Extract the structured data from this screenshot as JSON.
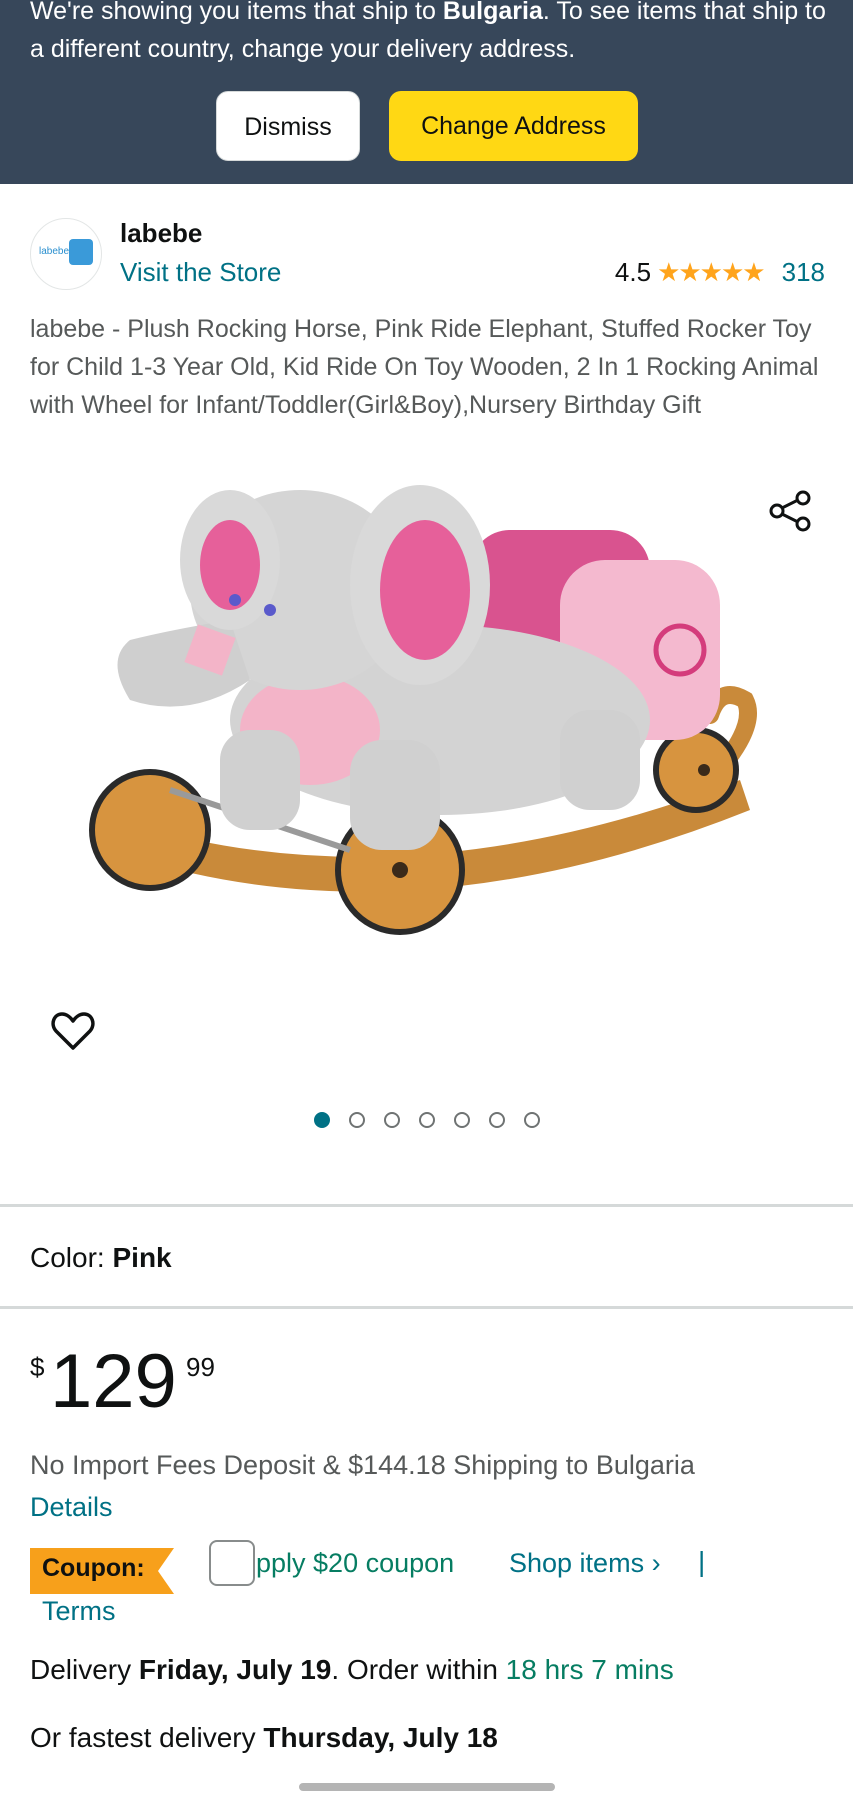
{
  "banner": {
    "text_part1": "We're showing you items that ship to ",
    "country": "Bulgaria",
    "text_part2": ". To see items that ship to a different country, change your delivery address.",
    "dismiss_label": "Dismiss",
    "change_address_label": "Change Address"
  },
  "store": {
    "logo_text": "labebe",
    "brand": "labebe",
    "visit_label": "Visit the Store",
    "rating": "4.5",
    "stars": "★★★★★",
    "rating_count": "318"
  },
  "product": {
    "title": "labebe - Plush Rocking Horse, Pink Ride Elephant, Stuffed Rocker Toy for Child 1-3 Year Old, Kid Ride On Toy Wooden, 2 In 1 Rocking Animal with Wheel for Infant/Toddler(Girl&Boy),Nursery Birthday Gift",
    "image_count": 7,
    "active_image_index": 0
  },
  "color": {
    "label": "Color:",
    "value": "Pink"
  },
  "price": {
    "symbol": "$",
    "whole": "129",
    "fraction": "99"
  },
  "shipping": {
    "import_text": "No Import Fees Deposit & $144.18 Shipping to Bulgaria",
    "details_label": "Details"
  },
  "coupon": {
    "badge_label": "Coupon:",
    "apply_text": "pply $20 coupon",
    "shop_items_label": "Shop items ›",
    "separator": "|",
    "terms_label": "Terms"
  },
  "delivery": {
    "prefix": "Delivery ",
    "date": "Friday, July 19",
    "middle": ". Order within ",
    "countdown": "18 hrs 7 mins",
    "fastest_prefix": "Or fastest delivery ",
    "fastest_date": "Thursday, July 18"
  },
  "colors": {
    "banner_bg": "#37475a",
    "change_address_bg": "#ffd814",
    "link": "#007185",
    "green": "#067d62",
    "star": "#ffa41c",
    "coupon_badge": "#f7a01b"
  }
}
